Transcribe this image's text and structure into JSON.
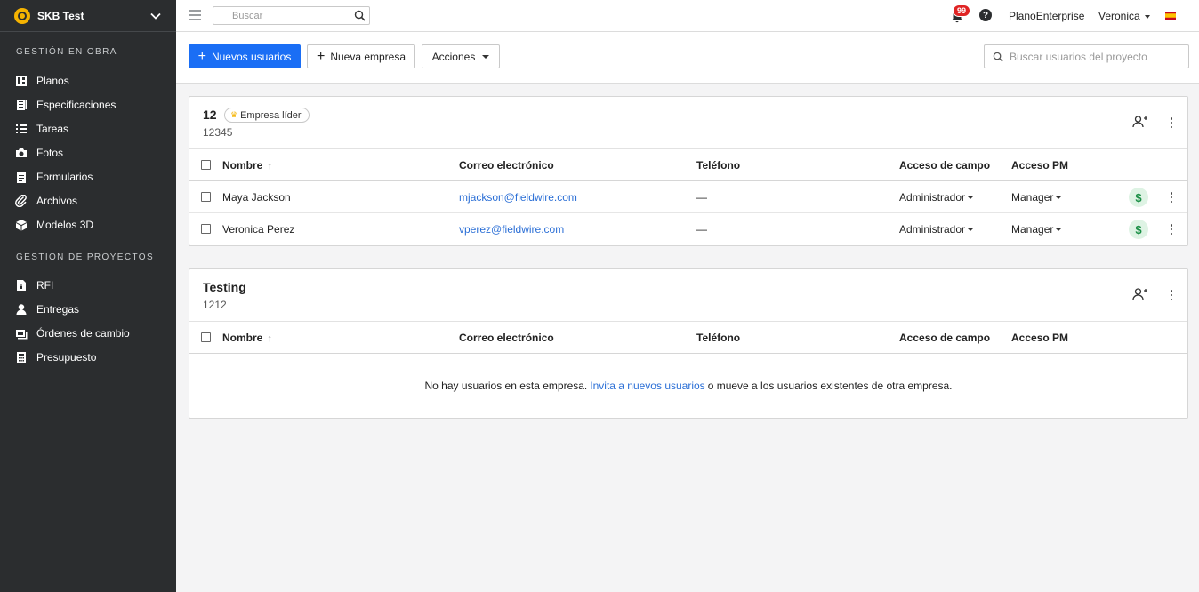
{
  "sidebar": {
    "project_title": "SKB Test",
    "sections": [
      {
        "label": "GESTIÓN EN OBRA"
      },
      {
        "label": "GESTIÓN DE PROYECTOS"
      }
    ],
    "items": [
      {
        "label": "Planos",
        "icon": "plans-icon"
      },
      {
        "label": "Especificaciones",
        "icon": "specifications-icon"
      },
      {
        "label": "Tareas",
        "icon": "tasks-icon"
      },
      {
        "label": "Fotos",
        "icon": "camera-icon"
      },
      {
        "label": "Formularios",
        "icon": "clipboard-icon"
      },
      {
        "label": "Archivos",
        "icon": "paperclip-icon"
      },
      {
        "label": "Modelos 3D",
        "icon": "cube-icon"
      },
      {
        "label": "RFI",
        "icon": "info-document-icon"
      },
      {
        "label": "Entregas",
        "icon": "user-icon"
      },
      {
        "label": "Órdenes de cambio",
        "icon": "change-order-icon"
      },
      {
        "label": "Presupuesto",
        "icon": "calculator-icon"
      }
    ]
  },
  "topbar": {
    "search_placeholder": "Buscar",
    "notifications_count": "99",
    "help_label": "?",
    "plan_name": "PlanoEnterprise",
    "user_name": "Veronica"
  },
  "actions": {
    "new_users": "Nuevos usuarios",
    "new_company": "Nueva empresa",
    "actions_menu": "Acciones",
    "search_users_placeholder": "Buscar usuarios del proyecto"
  },
  "table_headers": {
    "name": "Nombre",
    "email": "Correo electrónico",
    "phone": "Teléfono",
    "field_access": "Acceso de campo",
    "pm_access": "Acceso PM"
  },
  "companies": [
    {
      "name": "12",
      "code": "12345",
      "lead_tag": "Empresa líder",
      "users": [
        {
          "name": "Maya Jackson",
          "email": "mjackson@fieldwire.com",
          "phone": "—",
          "field_access": "Administrador",
          "pm_access": "Manager",
          "dollar": "$"
        },
        {
          "name": "Veronica Perez",
          "email": "vperez@fieldwire.com",
          "phone": "—",
          "field_access": "Administrador",
          "pm_access": "Manager",
          "dollar": "$"
        }
      ]
    },
    {
      "name": "Testing",
      "code": "1212",
      "empty": {
        "before": "No hay usuarios en esta empresa.",
        "link": "Invita a nuevos usuarios",
        "after": "o mueve a los usuarios existentes de otra empresa."
      }
    }
  ],
  "colors": {
    "sidebar_bg": "#2b2d2f",
    "primary": "#1a6ef5",
    "link": "#2b6fd6",
    "badge": "#e02424",
    "logo": "#f5b301"
  }
}
